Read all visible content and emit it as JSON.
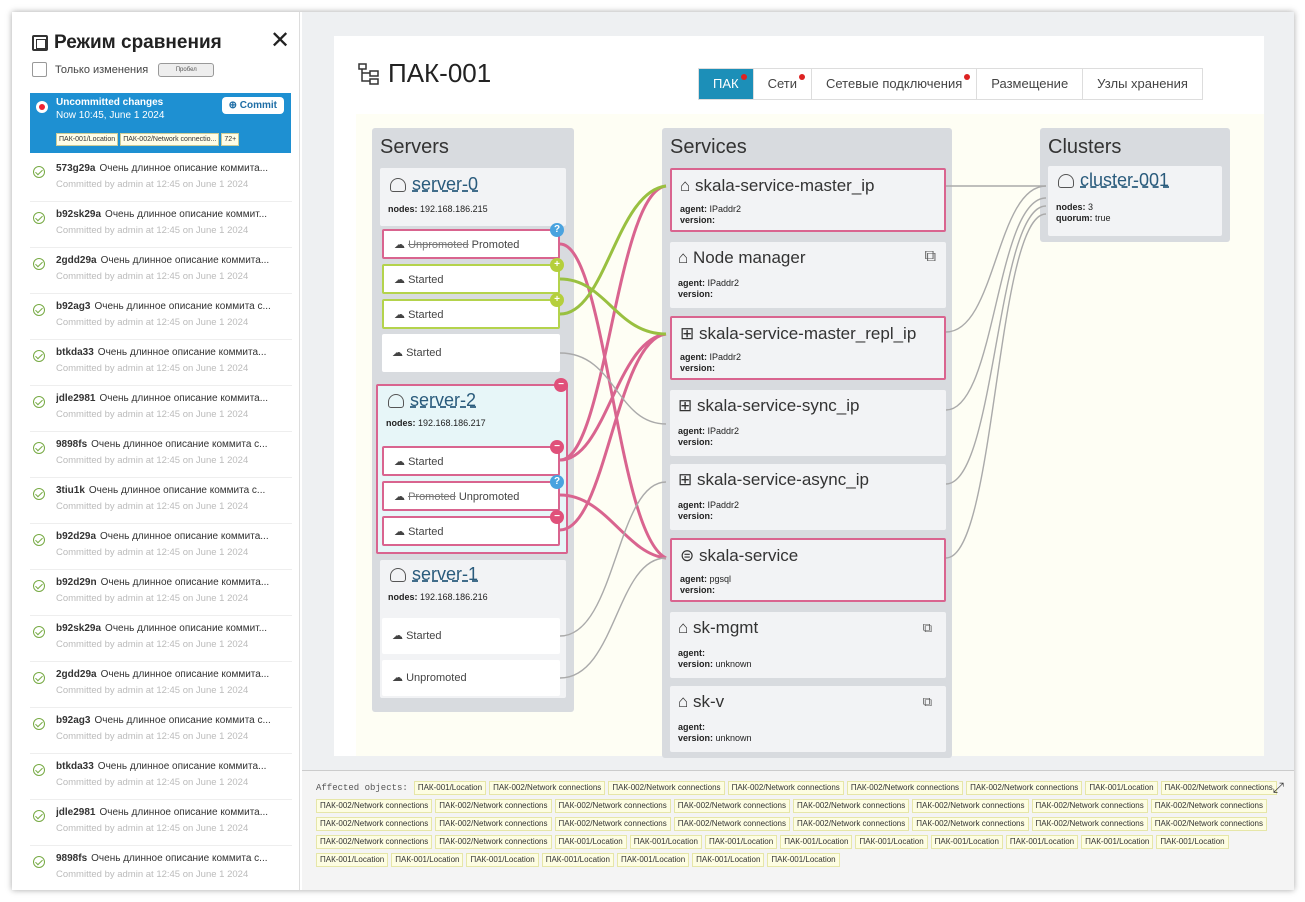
{
  "sidebar": {
    "title": "Режим сравнения",
    "only_changes": "Только изменения",
    "toggle": "Пробел",
    "uncommitted": {
      "title": "Uncommitted changes",
      "time": "Now 10:45, June 1 2024",
      "commit": "Commit",
      "tags": [
        "ПАК-001/Location",
        "ПАК-002/Network connectio...",
        "72+"
      ]
    },
    "commits": [
      {
        "hash": "573g29a",
        "desc": "Очень длинное описание коммита...",
        "meta": "Committed by admin at 12:45 on June 1 2024"
      },
      {
        "hash": "b92sk29a",
        "desc": "Очень длинное описание коммит...",
        "meta": "Committed by admin at 12:45 on June 1 2024"
      },
      {
        "hash": "2gdd29a",
        "desc": "Очень длинное описание коммита...",
        "meta": "Committed by admin at 12:45 on June 1 2024"
      },
      {
        "hash": "b92ag3",
        "desc": "Очень длинное описание коммита с...",
        "meta": "Committed by admin at 12:45 on June 1 2024"
      },
      {
        "hash": "btkda33",
        "desc": "Очень длинное описание коммита...",
        "meta": "Committed by admin at 12:45 on June 1 2024"
      },
      {
        "hash": "jdle2981",
        "desc": "Очень длинное описание коммита...",
        "meta": "Committed by admin at 12:45 on June 1 2024"
      },
      {
        "hash": "9898fs",
        "desc": "Очень длинное описание коммита с...",
        "meta": "Committed by admin at 12:45 on June 1 2024"
      },
      {
        "hash": "3tiu1k",
        "desc": "Очень длинное описание коммита с...",
        "meta": "Committed by admin at 12:45 on June 1 2024"
      },
      {
        "hash": "b92d29a",
        "desc": "Очень длинное описание коммита...",
        "meta": "Committed by admin at 12:45 on June 1 2024"
      },
      {
        "hash": "b92d29n",
        "desc": "Очень длинное описание коммита...",
        "meta": "Committed by admin at 12:45 on June 1 2024"
      },
      {
        "hash": "b92sk29a",
        "desc": "Очень длинное описание коммит...",
        "meta": "Committed by admin at 12:45 on June 1 2024"
      },
      {
        "hash": "2gdd29a",
        "desc": "Очень длинное описание коммита...",
        "meta": "Committed by admin at 12:45 on June 1 2024"
      },
      {
        "hash": "b92ag3",
        "desc": "Очень длинное описание коммита с...",
        "meta": "Committed by admin at 12:45 on June 1 2024"
      },
      {
        "hash": "btkda33",
        "desc": "Очень длинное описание коммита...",
        "meta": "Committed by admin at 12:45 on June 1 2024"
      },
      {
        "hash": "jdle2981",
        "desc": "Очень длинное описание коммита...",
        "meta": "Committed by admin at 12:45 on June 1 2024"
      },
      {
        "hash": "9898fs",
        "desc": "Очень длинное описание коммита с...",
        "meta": "Committed by admin at 12:45 on June 1 2024"
      }
    ]
  },
  "page": {
    "title": "ПАК-001",
    "tabs": [
      "ПАК",
      "Сети",
      "Сетевые подключения",
      "Размещение",
      "Узлы хранения"
    ]
  },
  "servers": {
    "title": "Servers",
    "server0": {
      "name": "server-0",
      "nodes_label": "nodes:",
      "nodes": "192.168.186.215",
      "res1_old": "Unpromoted",
      "res1_new": "Promoted",
      "res2": "Started",
      "res3": "Started",
      "res4": "Started"
    },
    "server2": {
      "name": "server-2",
      "nodes_label": "nodes:",
      "nodes": "192.168.186.217",
      "res1": "Started",
      "res2_old": "Promoted",
      "res2_new": "Unpromoted",
      "res3": "Started"
    },
    "server1": {
      "name": "server-1",
      "nodes_label": "nodes:",
      "nodes": "192.168.186.216",
      "res1": "Started",
      "res2": "Unpromoted"
    }
  },
  "services": {
    "title": "Services",
    "agent_label": "agent:",
    "version_label": "version:",
    "items": [
      {
        "name": "skala-service-master_ip",
        "agent": "IPaddr2",
        "version": ""
      },
      {
        "name": "Node manager",
        "agent": "IPaddr2",
        "version": ""
      },
      {
        "name": "skala-service-master_repl_ip",
        "agent": "IPaddr2",
        "version": ""
      },
      {
        "name": "skala-service-sync_ip",
        "agent": "IPaddr2",
        "version": ""
      },
      {
        "name": "skala-service-async_ip",
        "agent": "IPaddr2",
        "version": ""
      },
      {
        "name": "skala-service",
        "agent": "pgsql",
        "version": ""
      },
      {
        "name": "sk-mgmt",
        "agent": "",
        "version": "unknown"
      },
      {
        "name": "sk-v",
        "agent": "",
        "version": "unknown"
      }
    ]
  },
  "clusters": {
    "title": "Clusters",
    "name": "cluster-001",
    "nodes_label": "nodes:",
    "nodes": "3",
    "quorum_label": "quorum:",
    "quorum": "true"
  },
  "affected": {
    "label": "Affected objects:",
    "tags": [
      "ПАК-001/Location",
      "ПАК-002/Network connections",
      "ПАК-002/Network connections",
      "ПАК-002/Network connections",
      "ПАК-002/Network connections",
      "ПАК-002/Network connections",
      "ПАК-001/Location",
      "ПАК-002/Network connections",
      "ПАК-002/Network connections",
      "ПАК-002/Network connections",
      "ПАК-002/Network connections",
      "ПАК-002/Network connections",
      "ПАК-002/Network connections",
      "ПАК-002/Network connections",
      "ПАК-002/Network connections",
      "ПАК-002/Network connections",
      "ПАК-002/Network connections",
      "ПАК-002/Network connections",
      "ПАК-002/Network connections",
      "ПАК-002/Network connections",
      "ПАК-002/Network connections",
      "ПАК-002/Network connections",
      "ПАК-002/Network connections",
      "ПАК-002/Network connections",
      "ПАК-002/Network connections",
      "ПАК-002/Network connections",
      "ПАК-001/Location",
      "ПАК-001/Location",
      "ПАК-001/Location",
      "ПАК-001/Location",
      "ПАК-001/Location",
      "ПАК-001/Location",
      "ПАК-001/Location",
      "ПАК-001/Location",
      "ПАК-001/Location",
      "ПАК-001/Location",
      "ПАК-001/Location",
      "ПАК-001/Location",
      "ПАК-001/Location",
      "ПАК-001/Location",
      "ПАК-001/Location",
      "ПАК-001/Location"
    ]
  },
  "colors": {
    "accent": "#1c8fb8",
    "added": "#b5cf3c",
    "removed": "#d9648f",
    "changed": "#4aa3df"
  }
}
